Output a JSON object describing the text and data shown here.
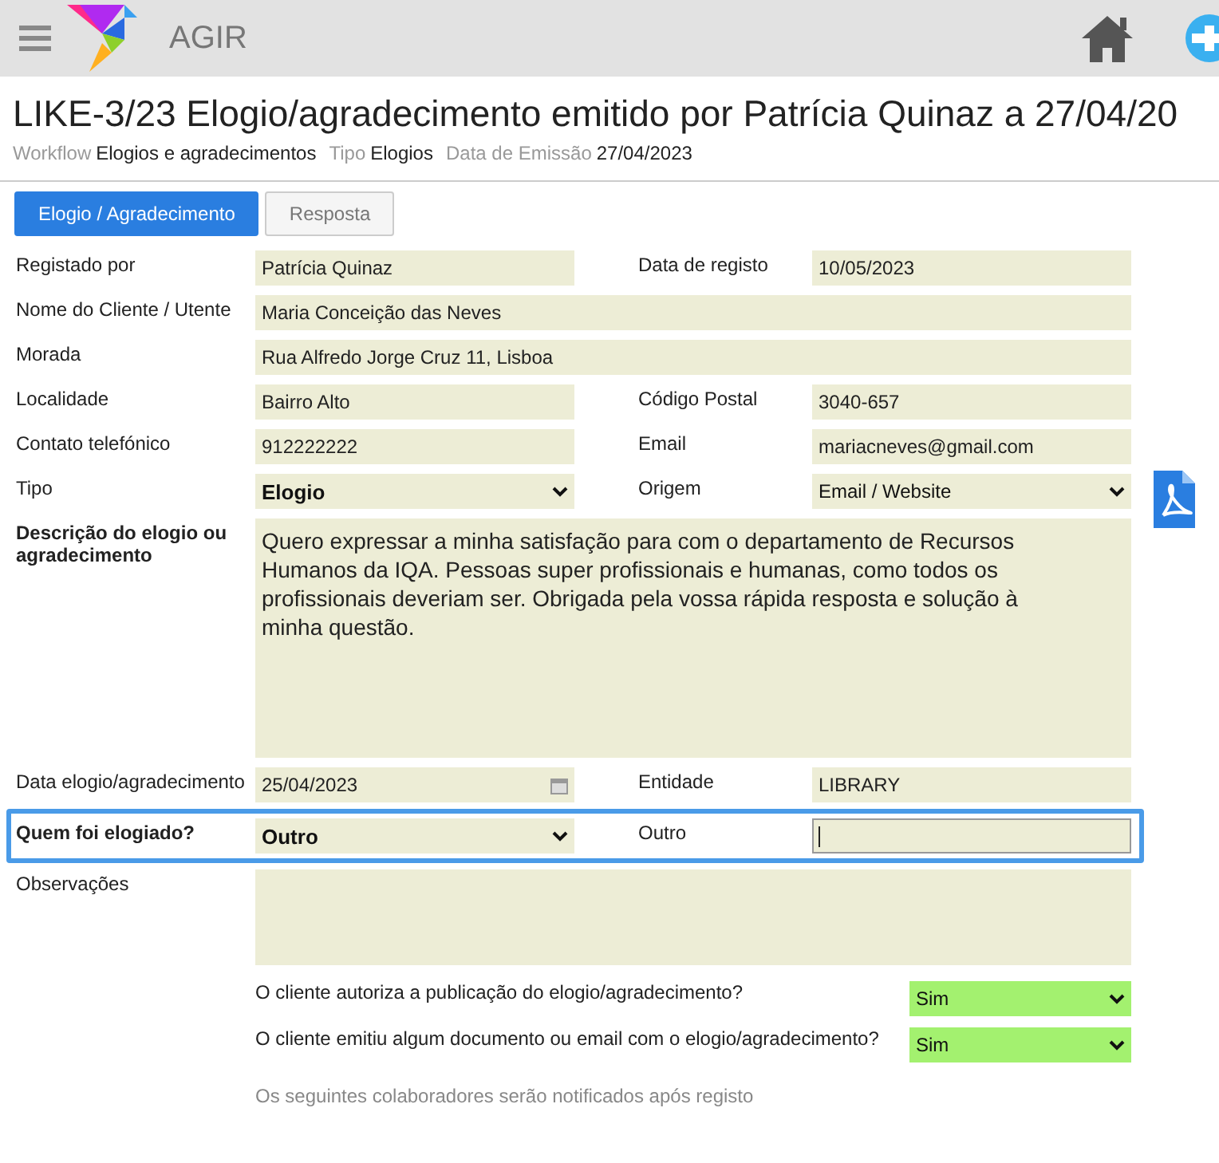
{
  "app": {
    "name": "AGIR"
  },
  "title": "LIKE-3/23 Elogio/agradecimento emitido por Patrícia Quinaz a 27/04/20",
  "meta": [
    {
      "label": "Workflow",
      "value": "Elogios e agradecimentos"
    },
    {
      "label": "Tipo",
      "value": "Elogios"
    },
    {
      "label": "Data de Emissão",
      "value": "27/04/2023"
    }
  ],
  "tabs": [
    {
      "label": "Elogio / Agradecimento",
      "selected": true
    },
    {
      "label": "Resposta",
      "selected": false
    }
  ],
  "rows": [
    {
      "kind": "pair",
      "left": {
        "label": "Registado por",
        "kind": "text",
        "value": "Patrícia Quinaz"
      },
      "right": {
        "label": "Data de registo",
        "kind": "text",
        "value": "10/05/2023"
      }
    },
    {
      "kind": "wide",
      "left": {
        "label": "Nome do Cliente / Utente",
        "kind": "text",
        "value": "Maria Conceição das Neves"
      }
    },
    {
      "kind": "wide",
      "left": {
        "label": "Morada",
        "kind": "text",
        "value": "Rua Alfredo Jorge Cruz 11, Lisboa"
      }
    },
    {
      "kind": "pair",
      "left": {
        "label": "Localidade",
        "kind": "text",
        "value": "Bairro Alto"
      },
      "right": {
        "label": "Código Postal",
        "kind": "text",
        "value": "3040-657"
      }
    },
    {
      "kind": "pair",
      "left": {
        "label": "Contato telefónico",
        "kind": "text",
        "value": "912222222"
      },
      "right": {
        "label": "Email",
        "kind": "text",
        "value": "mariacneves@gmail.com"
      }
    },
    {
      "kind": "pair",
      "pdf": true,
      "left": {
        "label": "Tipo",
        "kind": "select",
        "value": "Elogio"
      },
      "right": {
        "label": "Origem",
        "kind": "select",
        "value": "Email / Website"
      }
    },
    {
      "kind": "textarea",
      "left": {
        "label": "Descrição do elogio ou agradecimento",
        "bold": true,
        "kind": "textarea",
        "value": "Quero expressar a minha satisfação para com o departamento de Recursos Humanos da IQA. Pessoas super profissionais e humanas, como todos os profissionais deveriam ser. Obrigada pela vossa rápida resposta e solução à minha questão."
      }
    },
    {
      "kind": "pair",
      "left": {
        "label": "Data elogio/agradecimento",
        "kind": "date",
        "value": "25/04/2023"
      },
      "right": {
        "label": "Entidade",
        "kind": "text",
        "value": "LIBRARY"
      }
    },
    {
      "kind": "pair",
      "highlighted": true,
      "left": {
        "label": "Quem foi elogiado?",
        "bold": true,
        "kind": "select",
        "value": "Outro"
      },
      "right": {
        "label": "Outro",
        "kind": "input",
        "focused": true
      }
    },
    {
      "kind": "textarea",
      "left": {
        "label": "Observações",
        "kind": "textarea",
        "short": true
      }
    }
  ],
  "questions": [
    {
      "label": "O cliente autoriza a publicação do elogio/agradecimento?",
      "value": "Sim"
    },
    {
      "label": "O cliente emitiu algum documento ou email com o elogio/agradecimento?",
      "value": "Sim"
    }
  ],
  "notice": "Os seguintes colaboradores serão notificados após registo"
}
